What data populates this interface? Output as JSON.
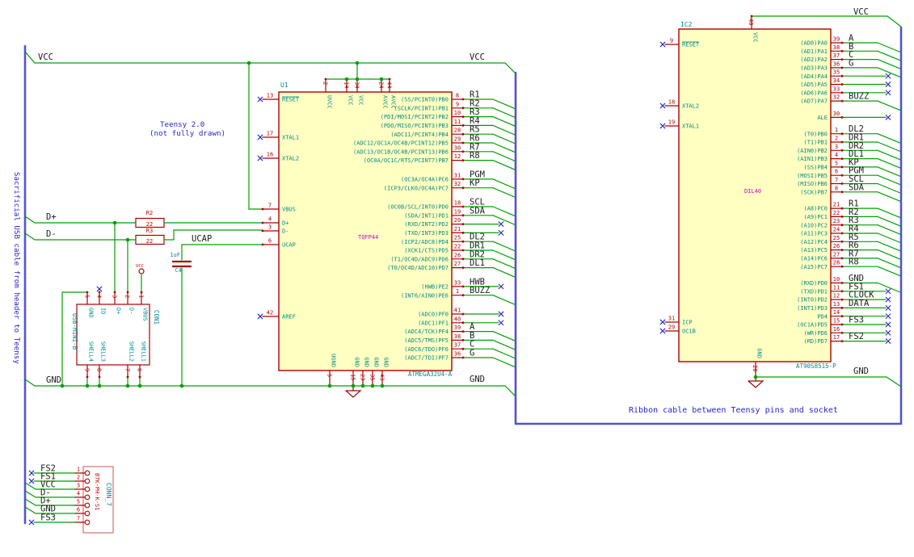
{
  "notes": {
    "sidebar_note": "Sacrificial USB cable from header to Teensy",
    "teensy_line1": "Teensy 2.0",
    "teensy_line2": "(not fully drawn)",
    "ribbon_note": "Ribbon cable between Teensy pins and socket"
  },
  "nets": {
    "vcc": "VCC",
    "gnd": "GND",
    "dplus": "D+",
    "dminus": "D-",
    "ucap": "UCAP"
  },
  "u1": {
    "ref": "U1",
    "footprint": "TQFP44",
    "part": "ATMEGA32U4-A",
    "top_pins": [
      {
        "num": "2",
        "name": "UVCC"
      },
      {
        "num": "14",
        "name": "VCC"
      },
      {
        "num": "34",
        "name": "VCC"
      },
      {
        "num": "24",
        "name": "AVCC"
      },
      {
        "num": "44",
        "name": "AVCC"
      }
    ],
    "bottom_pins": [
      {
        "num": "5",
        "name": "UGND"
      },
      {
        "num": "15",
        "name": "GND"
      },
      {
        "num": "23",
        "name": "GND"
      },
      {
        "num": "35",
        "name": "GND"
      },
      {
        "num": "43",
        "name": "GND"
      }
    ],
    "left_pins": [
      {
        "num": "13",
        "name": "RESET",
        "overline": true,
        "nc": true
      },
      {
        "num": "17",
        "name": "XTAL1",
        "nc": true
      },
      {
        "num": "16",
        "name": "XTAL2",
        "nc": true
      },
      {
        "num": "7",
        "name": "VBUS"
      },
      {
        "num": "4",
        "name": "D+"
      },
      {
        "num": "3",
        "name": "D-"
      },
      {
        "num": "6",
        "name": "UCAP"
      },
      {
        "num": "42",
        "name": "AREF",
        "nc": true
      }
    ],
    "right_groups": [
      {
        "rows": [
          {
            "num": "8",
            "name": "(SS/PCINT0)PB0",
            "net": "R1",
            "conn": "bus"
          },
          {
            "num": "9",
            "name": "(SCLK/PCINT1)PB1",
            "net": "R2",
            "conn": "bus"
          },
          {
            "num": "10",
            "name": "(PDI/MOSI/PCINT2)PB2",
            "net": "R3",
            "conn": "bus"
          },
          {
            "num": "11",
            "name": "(PDO/MISO/PCINT3)PB3",
            "net": "R4",
            "conn": "bus"
          },
          {
            "num": "28",
            "name": "(ADC11/PCINT4)PB4",
            "net": "R5",
            "conn": "bus"
          },
          {
            "num": "29",
            "name": "(ADC12/OC1A/OC4B/PCINT12)PB5",
            "net": "R6",
            "conn": "bus"
          },
          {
            "num": "30",
            "name": "(ADC13/OC1B/OC4B/PCINT13)PB6",
            "net": "R7",
            "conn": "bus"
          },
          {
            "num": "12",
            "name": "(OC0A/OC1C/RTS/PCINT7)PB7",
            "net": "R8",
            "conn": "bus"
          }
        ]
      },
      {
        "rows": [
          {
            "num": "31",
            "name": "(OC3A/OC4A)PC6",
            "net": "PGM",
            "conn": "bus"
          },
          {
            "num": "32",
            "name": "(ICP3/CLK0/OC4A)PC7",
            "net": "KP",
            "conn": "bus"
          }
        ]
      },
      {
        "rows": [
          {
            "num": "18",
            "name": "(OC0B/SCL/INT0)PD0",
            "net": "SCL",
            "conn": "bus"
          },
          {
            "num": "19",
            "name": "(SDA/INT1)PD1",
            "net": "SDA",
            "conn": "bus"
          },
          {
            "num": "20",
            "name": "(RXD/INT2)PD2",
            "net": "",
            "conn": "nc"
          },
          {
            "num": "21",
            "name": "(TXD/INT3)PD3",
            "net": "",
            "conn": "nc"
          },
          {
            "num": "25",
            "name": "(ICP2/ADC8)PD4",
            "net": "DL2",
            "conn": "bus"
          },
          {
            "num": "22",
            "name": "(XCK1/CTS)PD5",
            "net": "DR1",
            "conn": "bus"
          },
          {
            "num": "26",
            "name": "(T1/OC4D/ADC9)PD6",
            "net": "DR2",
            "conn": "bus"
          },
          {
            "num": "27",
            "name": "(T0/OC4D/ADC10)PD7",
            "net": "DL1",
            "conn": "bus"
          }
        ]
      },
      {
        "rows": [
          {
            "num": "33",
            "name": "(HWB)PE2",
            "net": "HWB",
            "conn": "nc"
          },
          {
            "num": "1",
            "name": "(INT6/AIN0)PE6",
            "net": "BUZZ",
            "conn": "bus"
          }
        ]
      },
      {
        "rows": [
          {
            "num": "41",
            "name": "(ADC0)PF0",
            "net": "",
            "conn": "nc"
          },
          {
            "num": "40",
            "name": "(ADC1)PF1",
            "net": "",
            "conn": "nc"
          },
          {
            "num": "39",
            "name": "(ADC4/TCK)PF4",
            "net": "A",
            "conn": "bus"
          },
          {
            "num": "38",
            "name": "(ADC5/TMS)PF5",
            "net": "B",
            "conn": "bus"
          },
          {
            "num": "37",
            "name": "(ADC6/TDO)PF6",
            "net": "C",
            "conn": "bus"
          },
          {
            "num": "36",
            "name": "(ADC7/TDI)PF7",
            "net": "G",
            "conn": "bus"
          }
        ]
      }
    ]
  },
  "ic2": {
    "ref": "IC2",
    "footprint": "DIL40",
    "part": "AT90S8515-P",
    "top_pins": [
      {
        "num": "40",
        "name": "VCC"
      }
    ],
    "bottom_pins": [
      {
        "num": "20",
        "name": "GND"
      }
    ],
    "left_pins": [
      {
        "num": "9",
        "name": "RESET",
        "overline": true,
        "nc": true
      },
      {
        "num": "18",
        "name": "XTAL2",
        "nc": true
      },
      {
        "num": "19",
        "name": "XTAL1",
        "nc": true
      },
      {
        "num": "31",
        "name": "ICP",
        "nc": true
      },
      {
        "num": "29",
        "name": "OC1B",
        "nc": true
      }
    ],
    "right_groups": [
      {
        "rows": [
          {
            "num": "39",
            "name": "(AD0)PA0",
            "net": "A",
            "conn": "bus"
          },
          {
            "num": "38",
            "name": "(AD1)PA1",
            "net": "B",
            "conn": "bus"
          },
          {
            "num": "37",
            "name": "(AD2)PA2",
            "net": "C",
            "conn": "bus"
          },
          {
            "num": "36",
            "name": "(AD3)PA3",
            "net": "G",
            "conn": "bus"
          },
          {
            "num": "35",
            "name": "(AD4)PA4",
            "net": "",
            "conn": "nc"
          },
          {
            "num": "34",
            "name": "(AD5)PA5",
            "net": "",
            "conn": "nc"
          },
          {
            "num": "33",
            "name": "(AD6)PA6",
            "net": "",
            "conn": "nc"
          },
          {
            "num": "32",
            "name": "(AD7)PA7",
            "net": "BUZZ",
            "conn": "bus"
          }
        ]
      },
      {
        "rows": [
          {
            "num": "30",
            "name": "ALE",
            "net": "",
            "conn": "nc"
          }
        ]
      },
      {
        "rows": [
          {
            "num": "1",
            "name": "(T0)PB0",
            "net": "DL2",
            "conn": "bus"
          },
          {
            "num": "2",
            "name": "(T1)PB1",
            "net": "DR1",
            "conn": "bus"
          },
          {
            "num": "3",
            "name": "(AIN0)PB2",
            "net": "DR2",
            "conn": "bus"
          },
          {
            "num": "4",
            "name": "(AIN1)PB3",
            "net": "DL1",
            "conn": "bus"
          },
          {
            "num": "5",
            "name": "(SS)PB4",
            "net": "KP",
            "conn": "bus"
          },
          {
            "num": "6",
            "name": "(MOSI)PB5",
            "net": "PGM",
            "conn": "bus"
          },
          {
            "num": "7",
            "name": "(MISO)PB6",
            "net": "SCL",
            "conn": "bus"
          },
          {
            "num": "8",
            "name": "(SCK)PB7",
            "net": "SDA",
            "conn": "bus"
          }
        ]
      },
      {
        "rows": [
          {
            "num": "21",
            "name": "(A8)PC0",
            "net": "R1",
            "conn": "bus"
          },
          {
            "num": "22",
            "name": "(A9)PC1",
            "net": "R2",
            "conn": "bus"
          },
          {
            "num": "23",
            "name": "(A10)PC2",
            "net": "R3",
            "conn": "bus"
          },
          {
            "num": "24",
            "name": "(A11)PC3",
            "net": "R4",
            "conn": "bus"
          },
          {
            "num": "25",
            "name": "(A12)PC4",
            "net": "R5",
            "conn": "bus"
          },
          {
            "num": "26",
            "name": "(A13)PC5",
            "net": "R6",
            "conn": "bus"
          },
          {
            "num": "27",
            "name": "(A14)PC6",
            "net": "R7",
            "conn": "bus"
          },
          {
            "num": "28",
            "name": "(A15)PC7",
            "net": "R8",
            "conn": "bus"
          }
        ]
      },
      {
        "rows": [
          {
            "num": "10",
            "name": "(RXD)PD0",
            "net": "GND",
            "conn": "bus"
          },
          {
            "num": "11",
            "name": "(TXD)PD1",
            "net": "FS1",
            "conn": "nc"
          },
          {
            "num": "12",
            "name": "(INT0)PD2",
            "net": "CLOCK",
            "conn": "nc"
          },
          {
            "num": "13",
            "name": "(INT1)PD3",
            "net": "DATA",
            "conn": "nc"
          },
          {
            "num": "14",
            "name": "PD4",
            "net": "",
            "conn": "nc"
          },
          {
            "num": "15",
            "name": "(OC1A)PD5",
            "net": "FS3",
            "conn": "nc"
          },
          {
            "num": "16",
            "name": "(WR)PD6",
            "net": "",
            "conn": "nc"
          },
          {
            "num": "17",
            "name": "(RD)PD7",
            "net": "FS2",
            "conn": "nc"
          }
        ]
      }
    ]
  },
  "usb": {
    "value": "USB-MINI-B",
    "ref": "CON1",
    "top_pins": [
      {
        "num": "5",
        "name": "GND"
      },
      {
        "num": "4",
        "name": "ID",
        "nc": true
      },
      {
        "num": "3",
        "name": "D+"
      },
      {
        "num": "2",
        "name": "D-"
      },
      {
        "num": "1",
        "name": "VBUS"
      }
    ],
    "bottom_pins": [
      {
        "num": "9",
        "name": "SHELL4"
      },
      {
        "num": "8",
        "name": "SHELL3"
      },
      {
        "num": "7",
        "name": "SHELL2"
      },
      {
        "num": "6",
        "name": "SHELL1"
      }
    ]
  },
  "conn7": {
    "value": "B7K-PH-K-S1",
    "ref": "CONN_7",
    "pins": [
      {
        "num": "1",
        "net": "FS2",
        "conn": "nc"
      },
      {
        "num": "2",
        "net": "FS1",
        "conn": "nc"
      },
      {
        "num": "3",
        "net": "VCC",
        "conn": "bus"
      },
      {
        "num": "4",
        "net": "D-",
        "conn": "bus"
      },
      {
        "num": "5",
        "net": "D+",
        "conn": "bus"
      },
      {
        "num": "6",
        "net": "GND",
        "conn": "bus"
      },
      {
        "num": "7",
        "net": "FS3",
        "conn": "nc"
      }
    ]
  },
  "r2": {
    "ref": "R2",
    "value": "22"
  },
  "r3": {
    "ref": "R3",
    "value": "22"
  },
  "c4": {
    "ref": "C4",
    "value": "1uF"
  },
  "colors": {
    "wire": "#00a000",
    "bus": "#5353d1",
    "pin": "#aa0000",
    "body_fill": "#ffffc2",
    "outline": "#aa0000",
    "field_teal": "#008b8b",
    "footprint_magenta": "#cc00cc",
    "net_label": "#1b1b1b",
    "no_connect": "#2828cc",
    "note_blue": "#2626cf",
    "conn7_outline": "#d87070"
  }
}
